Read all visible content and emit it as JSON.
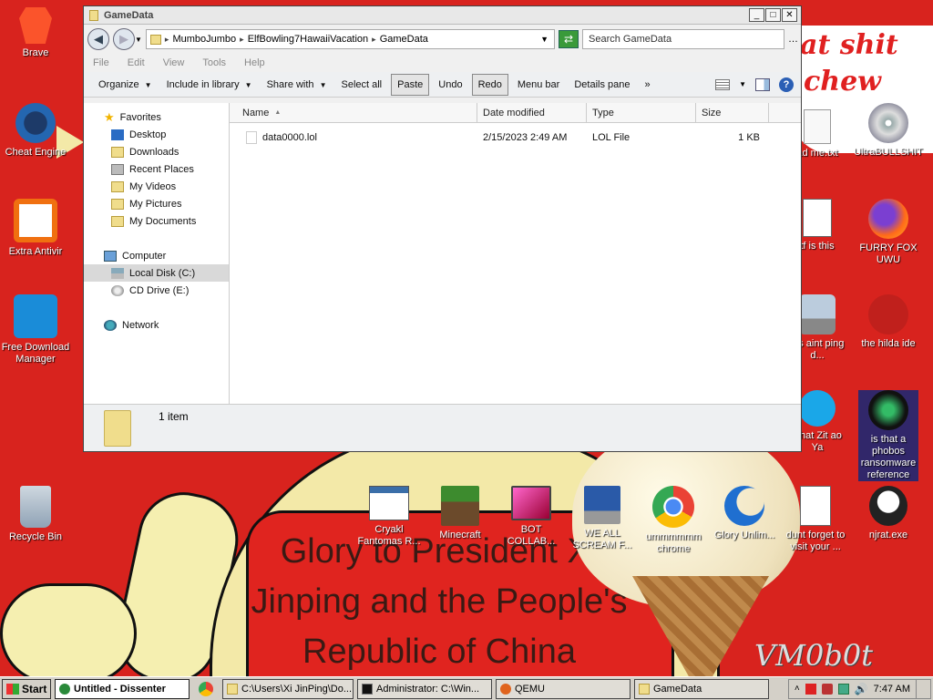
{
  "window": {
    "title": "GameData",
    "address": [
      "MumboJumbo",
      "ElfBowling7HawaiiVacation",
      "GameData"
    ],
    "search_placeholder": "Search GameData",
    "menu": [
      "File",
      "Edit",
      "View",
      "Tools",
      "Help"
    ],
    "commands": [
      "Organize",
      "Include in library",
      "Share with",
      "Select all",
      "Paste",
      "Undo",
      "Redo",
      "Menu bar",
      "Details pane",
      "»"
    ],
    "nav": {
      "favorites": "Favorites",
      "fav_items": [
        "Desktop",
        "Downloads",
        "Recent Places",
        "My Videos",
        "My Pictures",
        "My Documents"
      ],
      "computer": "Computer",
      "drives": [
        "Local Disk (C:)",
        "CD Drive (E:)"
      ],
      "network": "Network"
    },
    "columns": [
      "Name",
      "Date modified",
      "Type",
      "Size"
    ],
    "files": [
      {
        "name": "data0000.lol",
        "date": "2/15/2023 2:49 AM",
        "type": "LOL File",
        "size": "1 KB"
      }
    ],
    "status": "1 item"
  },
  "desktop_icons": [
    {
      "label": "Brave",
      "icon": "brave-icon"
    },
    {
      "label": "Cheat Engine",
      "icon": "cheat-engine-icon"
    },
    {
      "label": "Extra Antivir",
      "icon": "antivirus-icon"
    },
    {
      "label": "Free Download Manager",
      "icon": "download-manager-icon"
    },
    {
      "label": "Recycle Bin",
      "icon": "recycle-bin-icon"
    },
    {
      "label": "UltraBULLSHIT",
      "icon": "cd-icon"
    },
    {
      "label": "FURRY FOX UWU",
      "icon": "firefox-icon"
    },
    {
      "label": "the hilda ide",
      "icon": "devcpp-icon"
    },
    {
      "label": "is that a phobos ransomware reference",
      "icon": "bug-icon"
    },
    {
      "label": "njrat.exe",
      "icon": "skull-icon"
    },
    {
      "label": "ad me.txt",
      "icon": "text-file-icon"
    },
    {
      "label": "tf is this",
      "icon": "document-icon"
    },
    {
      "label": "his aint ping d...",
      "icon": "computer-icon"
    },
    {
      "label": "what Zit ao Ya",
      "icon": "skype-icon"
    },
    {
      "label": "Cryakl Fantomas R...",
      "icon": "app-window-icon"
    },
    {
      "label": "Minecraft",
      "icon": "minecraft-icon"
    },
    {
      "label": "BOT COLLAB...",
      "icon": "monitor-icon"
    },
    {
      "label": "WE ALL SCREAM F...",
      "icon": "computer-icon"
    },
    {
      "label": "ummmmmm chrome",
      "icon": "chrome-icon"
    },
    {
      "label": "Glory Unlim...",
      "icon": "moon-icon"
    },
    {
      "label": "dunt forget to visit your ...",
      "icon": "document-icon"
    }
  ],
  "wallpaper": {
    "caption": "Glory to President Xi Jinping and the People's Republic of China",
    "speech1": "at shit",
    "speech2": "chew",
    "watermark": "VM0b0t"
  },
  "taskbar": {
    "start": "Start",
    "tasks": [
      "Untitled - Dissenter",
      "C:\\Users\\Xi JinPing\\Do...",
      "Administrator: C:\\Win...",
      "QEMU",
      "GameData"
    ],
    "time": "7:47 AM"
  },
  "colors": {
    "wallpaper_red": "#d8231e",
    "window_bg": "#f0f0f0",
    "selection": "#d9d9d9"
  }
}
